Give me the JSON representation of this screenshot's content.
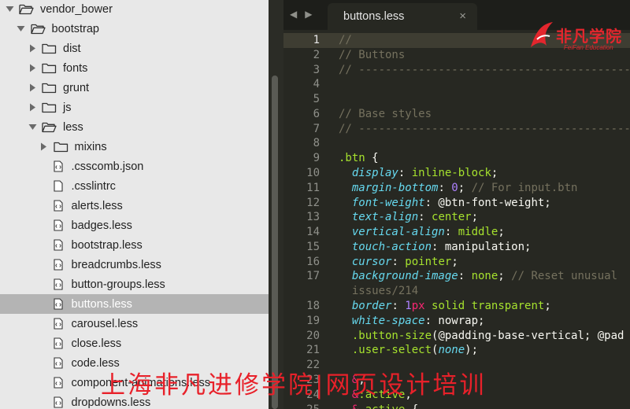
{
  "sidebar": {
    "items": [
      {
        "label": "vendor_bower",
        "type": "folder",
        "expanded": true,
        "depth": 0
      },
      {
        "label": "bootstrap",
        "type": "folder",
        "expanded": true,
        "depth": 1
      },
      {
        "label": "dist",
        "type": "folder",
        "expanded": false,
        "depth": 2
      },
      {
        "label": "fonts",
        "type": "folder",
        "expanded": false,
        "depth": 2
      },
      {
        "label": "grunt",
        "type": "folder",
        "expanded": false,
        "depth": 2
      },
      {
        "label": "js",
        "type": "folder",
        "expanded": false,
        "depth": 2
      },
      {
        "label": "less",
        "type": "folder",
        "expanded": true,
        "depth": 2
      },
      {
        "label": "mixins",
        "type": "folder",
        "expanded": false,
        "depth": 3
      },
      {
        "label": ".csscomb.json",
        "type": "code-file",
        "depth": 3
      },
      {
        "label": ".csslintrc",
        "type": "file",
        "depth": 3
      },
      {
        "label": "alerts.less",
        "type": "code-file",
        "depth": 3
      },
      {
        "label": "badges.less",
        "type": "code-file",
        "depth": 3
      },
      {
        "label": "bootstrap.less",
        "type": "code-file",
        "depth": 3
      },
      {
        "label": "breadcrumbs.less",
        "type": "code-file",
        "depth": 3
      },
      {
        "label": "button-groups.less",
        "type": "code-file",
        "depth": 3
      },
      {
        "label": "buttons.less",
        "type": "code-file",
        "depth": 3,
        "selected": true
      },
      {
        "label": "carousel.less",
        "type": "code-file",
        "depth": 3
      },
      {
        "label": "close.less",
        "type": "code-file",
        "depth": 3
      },
      {
        "label": "code.less",
        "type": "code-file",
        "depth": 3
      },
      {
        "label": "component-animations.less",
        "type": "code-file",
        "depth": 3
      },
      {
        "label": "dropdowns.less",
        "type": "code-file",
        "depth": 3
      }
    ]
  },
  "editor": {
    "tab_label": "buttons.less",
    "close_glyph": "×",
    "nav_back": "◀",
    "nav_forward": "▶",
    "current_line": 1,
    "lines": [
      {
        "n": "1",
        "tokens": [
          {
            "t": "//",
            "c": "com"
          }
        ]
      },
      {
        "n": "2",
        "tokens": [
          {
            "t": "// Buttons",
            "c": "com"
          }
        ]
      },
      {
        "n": "3",
        "tokens": [
          {
            "t": "// --------------------------------------------------",
            "c": "com"
          }
        ]
      },
      {
        "n": "4",
        "tokens": []
      },
      {
        "n": "5",
        "tokens": []
      },
      {
        "n": "6",
        "tokens": [
          {
            "t": "// Base styles",
            "c": "com"
          }
        ]
      },
      {
        "n": "7",
        "tokens": [
          {
            "t": "// --------------------------------------------------",
            "c": "com"
          }
        ]
      },
      {
        "n": "8",
        "tokens": []
      },
      {
        "n": "9",
        "tokens": [
          {
            "t": ".btn",
            "c": "sel"
          },
          {
            "t": " {",
            "c": "plain"
          }
        ]
      },
      {
        "n": "10",
        "tokens": [
          {
            "t": "  ",
            "c": "plain"
          },
          {
            "t": "display",
            "c": "prop"
          },
          {
            "t": ": ",
            "c": "plain"
          },
          {
            "t": "inline-block",
            "c": "val"
          },
          {
            "t": ";",
            "c": "plain"
          }
        ]
      },
      {
        "n": "11",
        "tokens": [
          {
            "t": "  ",
            "c": "plain"
          },
          {
            "t": "margin-bottom",
            "c": "prop"
          },
          {
            "t": ": ",
            "c": "plain"
          },
          {
            "t": "0",
            "c": "num"
          },
          {
            "t": "; ",
            "c": "plain"
          },
          {
            "t": "// For input.btn",
            "c": "com"
          }
        ]
      },
      {
        "n": "12",
        "tokens": [
          {
            "t": "  ",
            "c": "plain"
          },
          {
            "t": "font-weight",
            "c": "prop"
          },
          {
            "t": ": @btn-font-weight;",
            "c": "plain"
          }
        ]
      },
      {
        "n": "13",
        "tokens": [
          {
            "t": "  ",
            "c": "plain"
          },
          {
            "t": "text-align",
            "c": "prop"
          },
          {
            "t": ": ",
            "c": "plain"
          },
          {
            "t": "center",
            "c": "val"
          },
          {
            "t": ";",
            "c": "plain"
          }
        ]
      },
      {
        "n": "14",
        "tokens": [
          {
            "t": "  ",
            "c": "plain"
          },
          {
            "t": "vertical-align",
            "c": "prop"
          },
          {
            "t": ": ",
            "c": "plain"
          },
          {
            "t": "middle",
            "c": "val"
          },
          {
            "t": ";",
            "c": "plain"
          }
        ]
      },
      {
        "n": "15",
        "tokens": [
          {
            "t": "  ",
            "c": "plain"
          },
          {
            "t": "touch-action",
            "c": "prop"
          },
          {
            "t": ": manipulation;",
            "c": "plain"
          }
        ]
      },
      {
        "n": "16",
        "tokens": [
          {
            "t": "  ",
            "c": "plain"
          },
          {
            "t": "cursor",
            "c": "prop"
          },
          {
            "t": ": ",
            "c": "plain"
          },
          {
            "t": "pointer",
            "c": "val"
          },
          {
            "t": ";",
            "c": "plain"
          }
        ]
      },
      {
        "n": "17",
        "tokens": [
          {
            "t": "  ",
            "c": "plain"
          },
          {
            "t": "background-image",
            "c": "prop"
          },
          {
            "t": ": ",
            "c": "plain"
          },
          {
            "t": "none",
            "c": "val"
          },
          {
            "t": "; ",
            "c": "plain"
          },
          {
            "t": "// Reset unusual",
            "c": "com"
          }
        ]
      },
      {
        "n": "",
        "tokens": [
          {
            "t": "  ",
            "c": "plain"
          },
          {
            "t": "issues/214",
            "c": "com"
          }
        ]
      },
      {
        "n": "18",
        "tokens": [
          {
            "t": "  ",
            "c": "plain"
          },
          {
            "t": "border",
            "c": "prop"
          },
          {
            "t": ": ",
            "c": "plain"
          },
          {
            "t": "1",
            "c": "num"
          },
          {
            "t": "px",
            "c": "unit"
          },
          {
            "t": " ",
            "c": "plain"
          },
          {
            "t": "solid",
            "c": "val"
          },
          {
            "t": " ",
            "c": "plain"
          },
          {
            "t": "transparent",
            "c": "val"
          },
          {
            "t": ";",
            "c": "plain"
          }
        ]
      },
      {
        "n": "19",
        "tokens": [
          {
            "t": "  ",
            "c": "plain"
          },
          {
            "t": "white-space",
            "c": "prop"
          },
          {
            "t": ": nowrap;",
            "c": "plain"
          }
        ]
      },
      {
        "n": "20",
        "tokens": [
          {
            "t": "  ",
            "c": "plain"
          },
          {
            "t": ".button-size",
            "c": "sel"
          },
          {
            "t": "(@padding-base-vertical; @pad",
            "c": "plain"
          }
        ]
      },
      {
        "n": "21",
        "tokens": [
          {
            "t": "  ",
            "c": "plain"
          },
          {
            "t": ".user-select",
            "c": "sel"
          },
          {
            "t": "(",
            "c": "plain"
          },
          {
            "t": "none",
            "c": "prop"
          },
          {
            "t": ");",
            "c": "plain"
          }
        ]
      },
      {
        "n": "22",
        "tokens": []
      },
      {
        "n": "23",
        "tokens": [
          {
            "t": "  ",
            "c": "plain"
          },
          {
            "t": "&",
            "c": "kw"
          },
          {
            "t": ",",
            "c": "plain"
          }
        ]
      },
      {
        "n": "24",
        "tokens": [
          {
            "t": "  ",
            "c": "plain"
          },
          {
            "t": "&",
            "c": "kw"
          },
          {
            "t": ":active",
            "c": "sel"
          },
          {
            "t": ",",
            "c": "plain"
          }
        ]
      },
      {
        "n": "25",
        "tokens": [
          {
            "t": "  ",
            "c": "plain"
          },
          {
            "t": "&",
            "c": "kw"
          },
          {
            "t": ".active",
            "c": "sel"
          },
          {
            "t": " {",
            "c": "plain"
          }
        ]
      }
    ]
  },
  "watermark": {
    "logo_text": "非凡学院",
    "logo_sub": "FeiFan Education",
    "banner": "上海非凡进修学院|网页设计培训"
  },
  "colors": {
    "sidebar_bg": "#e8e8e8",
    "selection": "#b4b4b4",
    "editor_bg": "#272822",
    "watermark_red": "#e8212a"
  }
}
